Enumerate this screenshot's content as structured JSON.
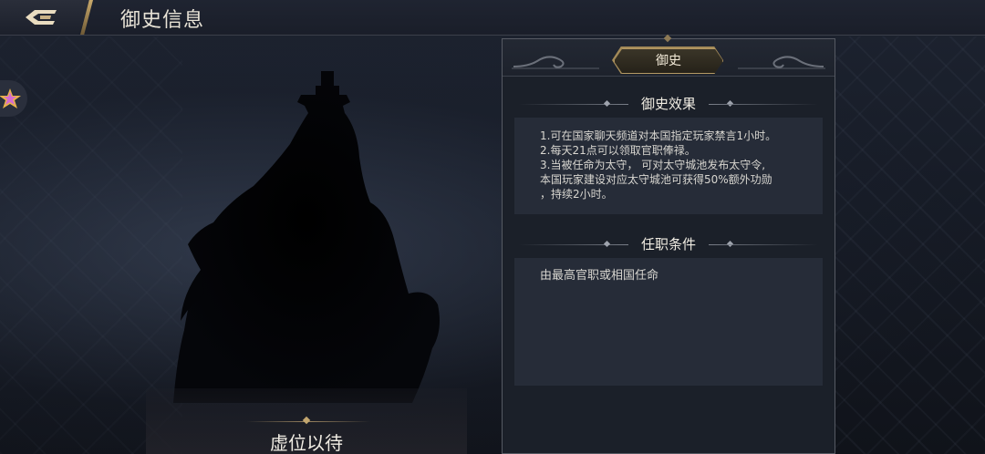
{
  "header": {
    "title": "御史信息",
    "back_icon": "back-arrow-icon"
  },
  "side": {
    "icon": "star-icon"
  },
  "character": {
    "name_status": "虚位以待"
  },
  "panel": {
    "badge": "御史",
    "effects": {
      "title": "御史效果",
      "lines": [
        "1.可在国家聊天频道对本国指定玩家禁言1小时。",
        "2.每天21点可以领取官职俸禄。",
        "3.当被任命为太守， 可对太守城池发布太守令,",
        "本国玩家建设对应太守城池可获得50%额外功勋",
        "，持续2小时。"
      ]
    },
    "conditions": {
      "title": "任职条件",
      "text": "由最高官职或相国任命"
    }
  },
  "colors": {
    "accent_gold": "#b59a64",
    "panel_bg": "#1b2029",
    "text_box_bg": "#262c38"
  }
}
